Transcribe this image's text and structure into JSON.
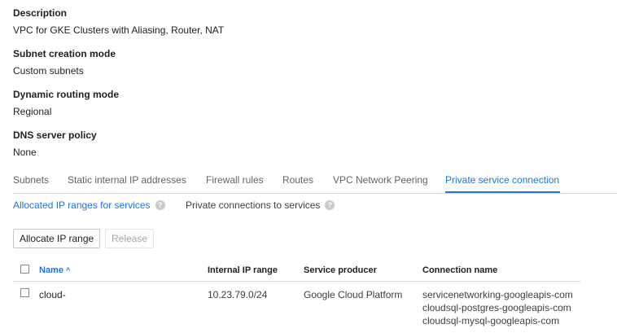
{
  "details": {
    "description": {
      "label": "Description",
      "value": "VPC for GKE Clusters with Aliasing, Router, NAT"
    },
    "subnet_mode": {
      "label": "Subnet creation mode",
      "value": "Custom subnets"
    },
    "routing_mode": {
      "label": "Dynamic routing mode",
      "value": "Regional"
    },
    "dns_policy": {
      "label": "DNS server policy",
      "value": "None"
    }
  },
  "tabs": [
    {
      "label": "Subnets"
    },
    {
      "label": "Static internal IP addresses"
    },
    {
      "label": "Firewall rules"
    },
    {
      "label": "Routes"
    },
    {
      "label": "VPC Network Peering"
    },
    {
      "label": "Private service connection",
      "active": true
    }
  ],
  "subtabs": [
    {
      "label": "Allocated IP ranges for services",
      "active": true
    },
    {
      "label": "Private connections to services"
    }
  ],
  "help_icon_glyph": "?",
  "buttons": {
    "allocate": "Allocate IP range",
    "release": "Release"
  },
  "table": {
    "headers": {
      "name": "Name",
      "internal_ip_range": "Internal IP range",
      "service_producer": "Service producer",
      "connection_name": "Connection name"
    },
    "sort_indicator": "^",
    "rows": [
      {
        "name": "cloud-",
        "internal_ip_range": "10.23.79.0/24",
        "service_producer": "Google Cloud Platform",
        "connection_names": [
          "servicenetworking-googleapis-com",
          "cloudsql-postgres-googleapis-com",
          "cloudsql-mysql-googleapis-com"
        ]
      }
    ]
  },
  "colors": {
    "accent": "#1a73e8",
    "text": "#202124",
    "muted": "#5f6368",
    "divider": "#dadce0"
  }
}
